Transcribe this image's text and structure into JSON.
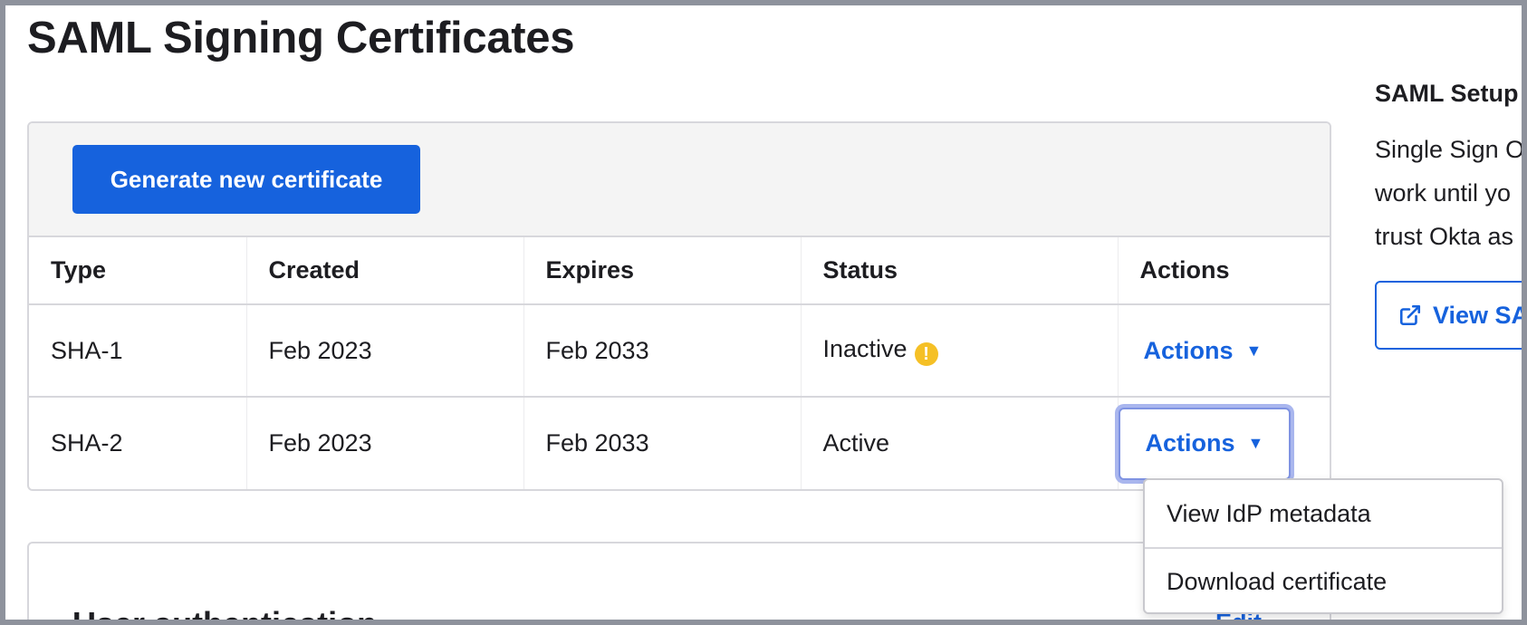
{
  "page": {
    "title": "SAML Signing Certificates"
  },
  "toolbar": {
    "generate_label": "Generate new certificate"
  },
  "table": {
    "headers": [
      "Type",
      "Created",
      "Expires",
      "Status",
      "Actions"
    ],
    "rows": [
      {
        "type": "SHA-1",
        "created": "Feb 2023",
        "expires": "Feb 2033",
        "status": "Inactive",
        "warning": true,
        "actions_label": "Actions"
      },
      {
        "type": "SHA-2",
        "created": "Feb 2023",
        "expires": "Feb 2033",
        "status": "Active",
        "warning": false,
        "actions_label": "Actions"
      }
    ]
  },
  "dropdown": {
    "items": [
      "View IdP metadata",
      "Download certificate"
    ]
  },
  "auth_panel": {
    "title": "User authentication",
    "edit_label": "Edit"
  },
  "sidebar": {
    "title": "SAML Setup",
    "text_lines": [
      "Single Sign O",
      "work until yo",
      "trust Okta as"
    ],
    "button_label": "View SA"
  },
  "colors": {
    "accent": "#1662dd",
    "warning": "#f5c026",
    "focus_ring": "#a9b6ee"
  },
  "icons": {
    "warning": "warning-icon",
    "caret": "caret-down-icon",
    "external": "external-link-icon"
  }
}
